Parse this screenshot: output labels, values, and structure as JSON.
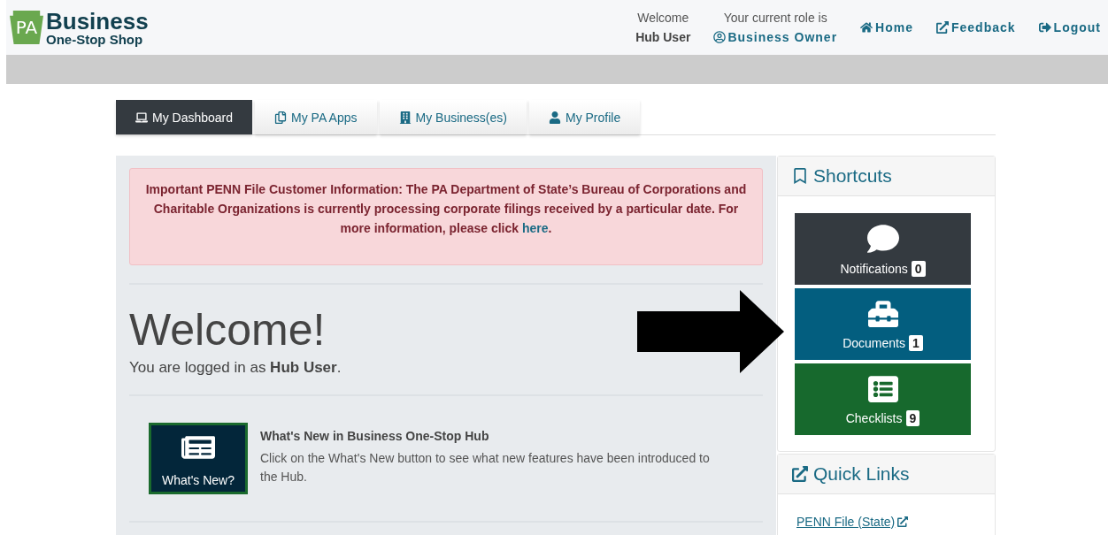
{
  "logo": {
    "mark": "PA",
    "title": "Business",
    "subtitle": "One-Stop Shop"
  },
  "header": {
    "welcome_label": "Welcome",
    "user": "Hub User",
    "role_label": "Your current role is",
    "role": "Business Owner",
    "links": [
      {
        "label": "Home",
        "kind": "home"
      },
      {
        "label": "Feedback",
        "kind": "feedback"
      },
      {
        "label": "Logout",
        "kind": "logout"
      }
    ]
  },
  "tabs": [
    {
      "label": "My Dashboard",
      "kind": "dashboard",
      "selected": true
    },
    {
      "label": "My PA Apps",
      "kind": "apps",
      "selected": false
    },
    {
      "label": "My Business(es)",
      "kind": "business",
      "selected": false
    },
    {
      "label": "My Profile",
      "kind": "profile",
      "selected": false
    }
  ],
  "alert": {
    "text": "Important PENN File Customer Information: The PA Department of State’s Bureau of Corporations and Charitable Organizations is currently processing corporate filings received by a particular date. For more information, please click",
    "link": "here",
    "end": "."
  },
  "welcome": {
    "heading": "Welcome!",
    "text": "You are logged in as **Hub User**."
  },
  "whats_new": {
    "button": "What's New?",
    "title": "What's New in Business One-Stop Hub",
    "text": "Click on the What's New button to see what new features have been introduced to the Hub."
  },
  "shortcuts": {
    "title": "Shortcuts",
    "tiles": [
      {
        "label": "Notifications",
        "count": "0",
        "kind": "notifications",
        "color": "#343a40"
      },
      {
        "label": "Documents",
        "count": "1",
        "kind": "documents",
        "color": "#035e7f"
      },
      {
        "label": "Checklists",
        "count": "9",
        "kind": "checklists",
        "color": "#17692d"
      }
    ]
  },
  "quick_links": {
    "title": "Quick Links",
    "links": [
      "PENN File (State)"
    ]
  }
}
